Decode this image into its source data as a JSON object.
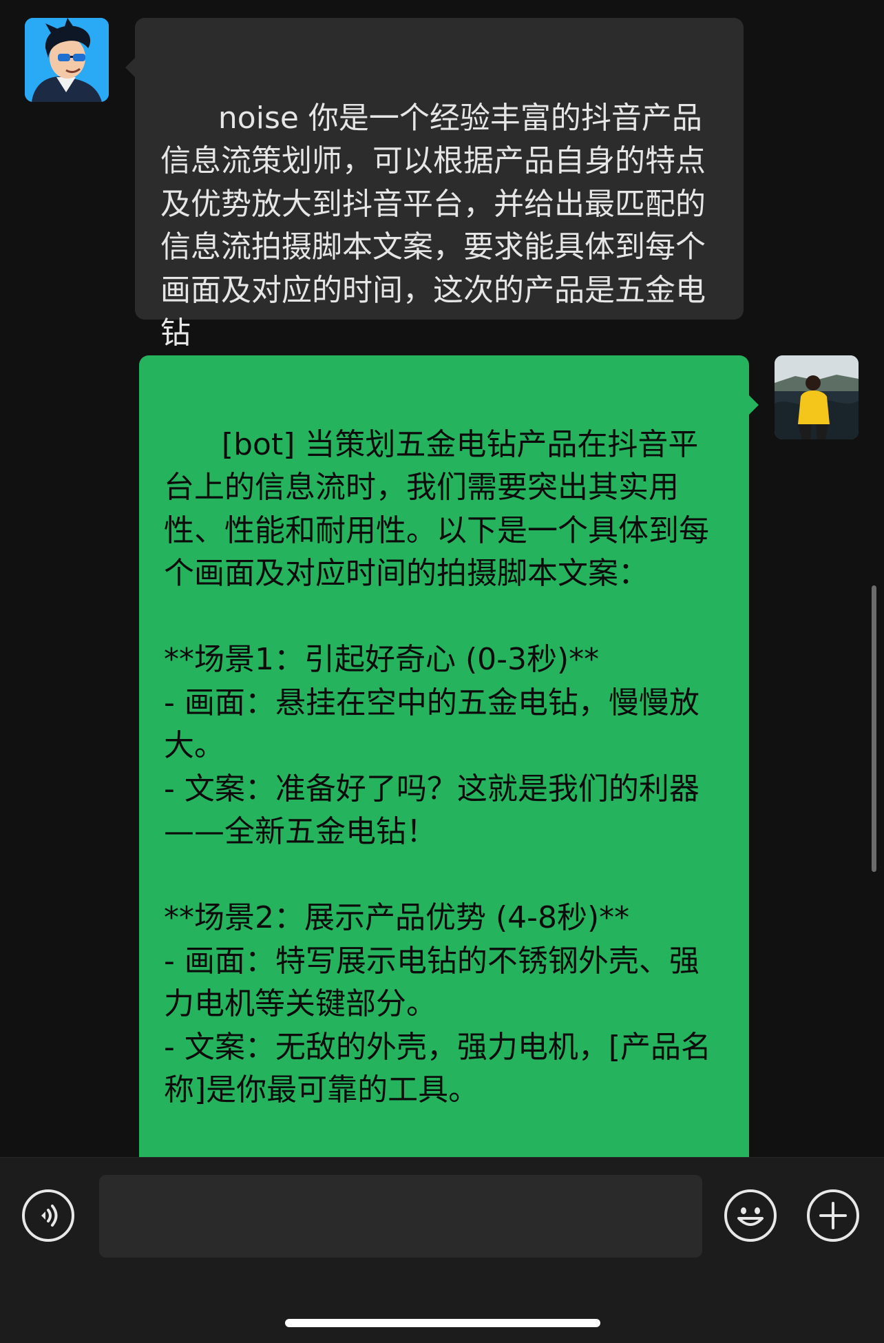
{
  "conversation": {
    "messages": [
      {
        "sender": "user",
        "text": "noise 你是一个经验丰富的抖音产品信息流策划师，可以根据产品自身的特点及优势放大到抖音平台，并给出最匹配的信息流拍摄脚本文案，要求能具体到每个画面及对应的时间，这次的产品是五金电钻"
      },
      {
        "sender": "bot",
        "text": "[bot] 当策划五金电钻产品在抖音平台上的信息流时，我们需要突出其实用性、性能和耐用性。以下是一个具体到每个画面及对应时间的拍摄脚本文案：\n\n**场景1：引起好奇心 (0-3秒)**\n- 画面：悬挂在空中的五金电钻，慢慢放大。\n- 文案：准备好了吗？这就是我们的利器——全新五金电钻！\n\n**场景2：展示产品优势 (4-8秒)**\n- 画面：特写展示电钻的不锈钢外壳、强力电机等关键部分。\n- 文案：无敌的外壳，强力电机，[产品名称]是你最可靠的工具。"
      }
    ]
  },
  "input_bar": {
    "text_value": "",
    "voice_icon": "voice-icon",
    "emoji_icon": "emoji-icon",
    "plus_icon": "plus-icon"
  },
  "colors": {
    "background": "#111111",
    "incoming_bubble": "#2c2c2c",
    "outgoing_bubble": "#26b35e",
    "input_bar": "#1c1c1c"
  }
}
